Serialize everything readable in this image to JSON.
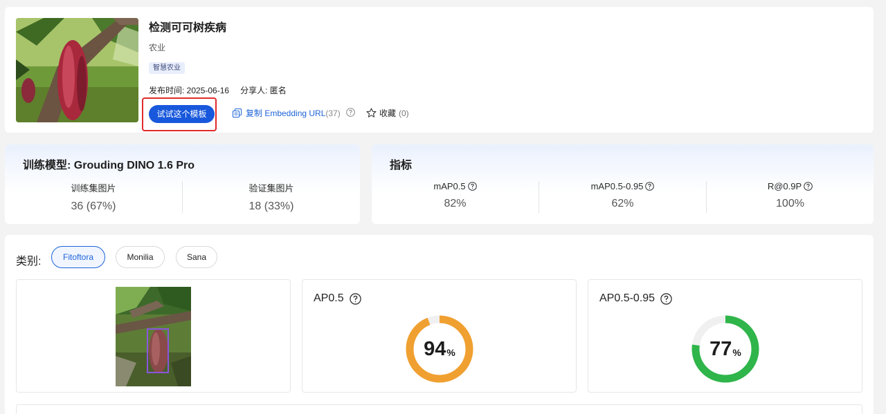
{
  "header": {
    "title": "检测可可树疾病",
    "category": "农业",
    "tag": "智慧农业",
    "publish_label": "发布时间: 2025-06-16",
    "sharer_label": "分享人: 匿名",
    "try_button": "试试这个模板",
    "copy_label": "复制 Embedding URL",
    "copy_count": "(37)",
    "fav_label": "收藏",
    "fav_count": "(0)"
  },
  "training": {
    "title": "训练模型: Grouding DINO 1.6 Pro",
    "columns": [
      {
        "label": "训练集图片",
        "value": "36 (67%)"
      },
      {
        "label": "验证集图片",
        "value": "18 (33%)"
      }
    ]
  },
  "metrics": {
    "title": "指标",
    "columns": [
      {
        "label": "mAP0.5",
        "value": "82%"
      },
      {
        "label": "mAP0.5-0.95",
        "value": "62%"
      },
      {
        "label": "R@0.9P",
        "value": "100%"
      }
    ]
  },
  "classes": {
    "label": "类别:",
    "chips": [
      "Fitoftora",
      "Monilia",
      "Sana"
    ],
    "selected": "Fitoftora"
  },
  "ap": {
    "ap50_title": "AP0.5",
    "ap50_value": "94",
    "ap50_fraction": 0.94,
    "ap50_color": "#f0a030",
    "ap5095_title": "AP0.5-0.95",
    "ap5095_value": "77",
    "ap5095_fraction": 0.77,
    "ap5095_color": "#2fb54a",
    "percent_sign": "%"
  }
}
